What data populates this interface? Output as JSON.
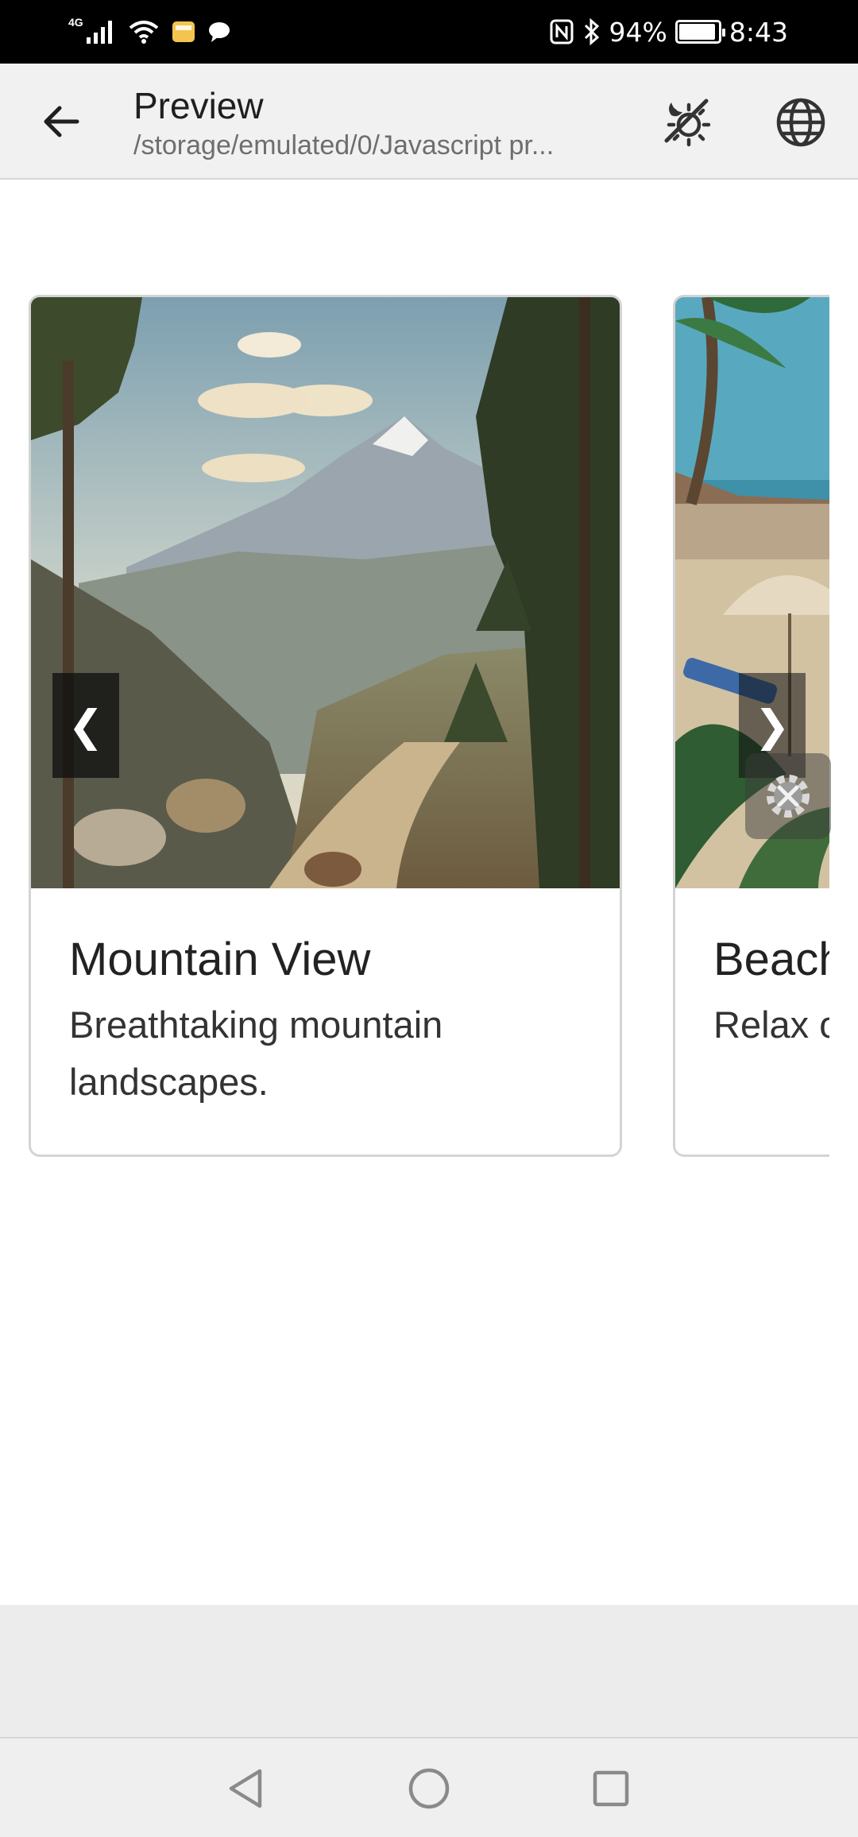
{
  "status_bar": {
    "network": "4G",
    "battery_text": "94%",
    "battery_level": 0.94,
    "time": "8:43"
  },
  "app_bar": {
    "title": "Preview",
    "subtitle": "/storage/emulated/0/Javascript pr...",
    "back_icon": "arrow-back-icon",
    "theme_icon": "theme-toggle-icon",
    "globe_icon": "globe-icon"
  },
  "carousel": {
    "prev_label": "❮",
    "next_label": "❯",
    "cards": [
      {
        "title": "Mountain View",
        "description": "Breathtaking mountain landscapes.",
        "image": "mountain-landscape"
      },
      {
        "title": "Beach",
        "description": "Relax on the beaches",
        "image": "beach-resort"
      }
    ]
  },
  "fab": {
    "icon": "settings-tools-icon"
  },
  "nav_bar": {
    "back_icon": "triangle-back-icon",
    "home_icon": "circle-home-icon",
    "recent_icon": "square-recent-icon"
  },
  "colors": {
    "status_bar": "#000000",
    "app_bar": "#f1f1f1",
    "card_border": "#d4d4d4",
    "bottom_area": "#ececec"
  }
}
